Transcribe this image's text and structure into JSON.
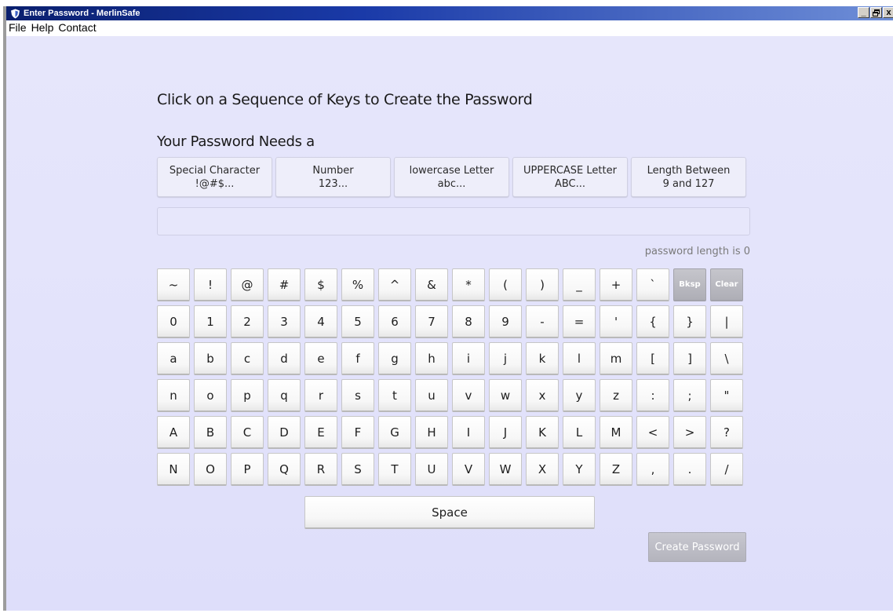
{
  "window": {
    "title": "Enter Password - MerlinSafe",
    "controls": {
      "minimize": "_",
      "restore": "🗗",
      "close": "x"
    },
    "icon": "shield-icon"
  },
  "menubar": {
    "items": [
      "File",
      "Help",
      "Contact"
    ]
  },
  "main": {
    "heading": "Click on a Sequence of Keys to Create the Password",
    "requirements_title": "Your Password Needs a",
    "requirements": [
      {
        "line1": "Special Character",
        "line2": "!@#$..."
      },
      {
        "line1": "Number",
        "line2": "123..."
      },
      {
        "line1": "lowercase Letter",
        "line2": "abc..."
      },
      {
        "line1": "UPPERCASE Letter",
        "line2": "ABC..."
      },
      {
        "line1": "Length Between",
        "line2": "9 and 127"
      }
    ],
    "password_value": "",
    "password_length_text": "password length is 0",
    "keyboard": {
      "rows": [
        [
          "~",
          "!",
          "@",
          "#",
          "$",
          "%",
          "^",
          "&",
          "*",
          "(",
          ")",
          "_",
          "+",
          "`"
        ],
        [
          "0",
          "1",
          "2",
          "3",
          "4",
          "5",
          "6",
          "7",
          "8",
          "9",
          "-",
          "=",
          "'",
          "{",
          "}",
          "|"
        ],
        [
          "a",
          "b",
          "c",
          "d",
          "e",
          "f",
          "g",
          "h",
          "i",
          "j",
          "k",
          "l",
          "m",
          "[",
          "]",
          "\\"
        ],
        [
          "n",
          "o",
          "p",
          "q",
          "r",
          "s",
          "t",
          "u",
          "v",
          "w",
          "x",
          "y",
          "z",
          ":",
          ";",
          "\""
        ],
        [
          "A",
          "B",
          "C",
          "D",
          "E",
          "F",
          "G",
          "H",
          "I",
          "J",
          "K",
          "L",
          "M",
          "<",
          ">",
          "?"
        ],
        [
          "N",
          "O",
          "P",
          "Q",
          "R",
          "S",
          "T",
          "U",
          "V",
          "W",
          "X",
          "Y",
          "Z",
          ",",
          ".",
          "/"
        ]
      ],
      "backspace_label": "Bksp",
      "clear_label": "Clear",
      "space_label": "Space"
    },
    "create_button_label": "Create Password"
  },
  "colors": {
    "titlebar_start": "#0a1f6e",
    "background": "#e3e3fb",
    "disabled_button": "#b4b4bd"
  }
}
